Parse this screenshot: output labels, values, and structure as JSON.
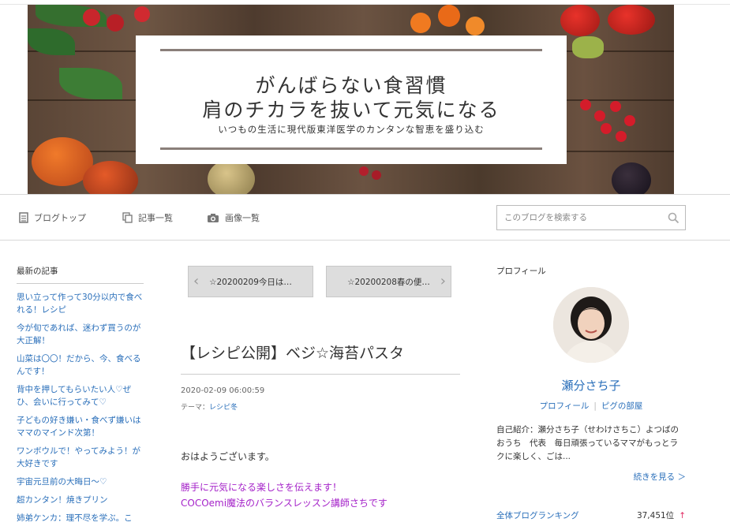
{
  "banner": {
    "title_line1": "がんばらない食習慣",
    "title_line2": "肩のチカラを抜いて元気になる",
    "subtitle": "いつもの生活に現代版東洋医学のカンタンな智恵を盛り込む"
  },
  "nav": {
    "items": [
      {
        "label": "ブログトップ",
        "icon": "document-icon"
      },
      {
        "label": "記事一覧",
        "icon": "copy-icon"
      },
      {
        "label": "画像一覧",
        "icon": "camera-icon"
      }
    ],
    "search_placeholder": "このブログを検索する"
  },
  "sidebar": {
    "title": "最新の記事",
    "articles": [
      "思い立って作って30分以内で食べれる！レシピ",
      "今が旬であれば、迷わず買うのが大正解！",
      "山菜は〇〇！だから、今、食べるんです！",
      "背中を押してもらいたい人♡ぜひ、会いに行ってみて♡",
      "子どもの好き嫌い・食べず嫌いはママのマインド次第！",
      "ワンボウルで！やってみよう！が大好きです",
      "宇宙元旦前の大晦日〜♡",
      "超カンタン！焼きプリン",
      "姉弟ケンカ：理不尽を学ぶ。こ"
    ]
  },
  "pager": {
    "prev_label": "☆20200209今日は…",
    "next_label": "☆20200208春の便…"
  },
  "entry": {
    "title": "【レシピ公開】ベジ☆海苔パスタ",
    "date": "2020-02-09 06:00:59",
    "theme_label": "テーマ：",
    "theme_value": "レシピ冬",
    "greeting": "おはようございます。",
    "line1": "勝手に元気になる楽しさを伝えます！",
    "line2": "COCOemi魔法のバランスレッスン講師さちです"
  },
  "profile": {
    "heading": "プロフィール",
    "name": "瀬分さち子",
    "link_profile": "プロフィール",
    "separator": "|",
    "link_room": "ピグの部屋",
    "intro": "自己紹介：瀬分さち子（せわけさちこ）よつばのおうち　代表　毎日頑張っているママがもっとラクに楽しく、ごは...",
    "more": "続きを見る ＞",
    "ranking_label": "全体ブログランキング",
    "ranking_value": "37,451位",
    "ranking_arrow": "↑"
  },
  "colors": {
    "link": "#2a6fba",
    "accent_purple": "#a523c9",
    "rank_up": "#e0245e"
  }
}
